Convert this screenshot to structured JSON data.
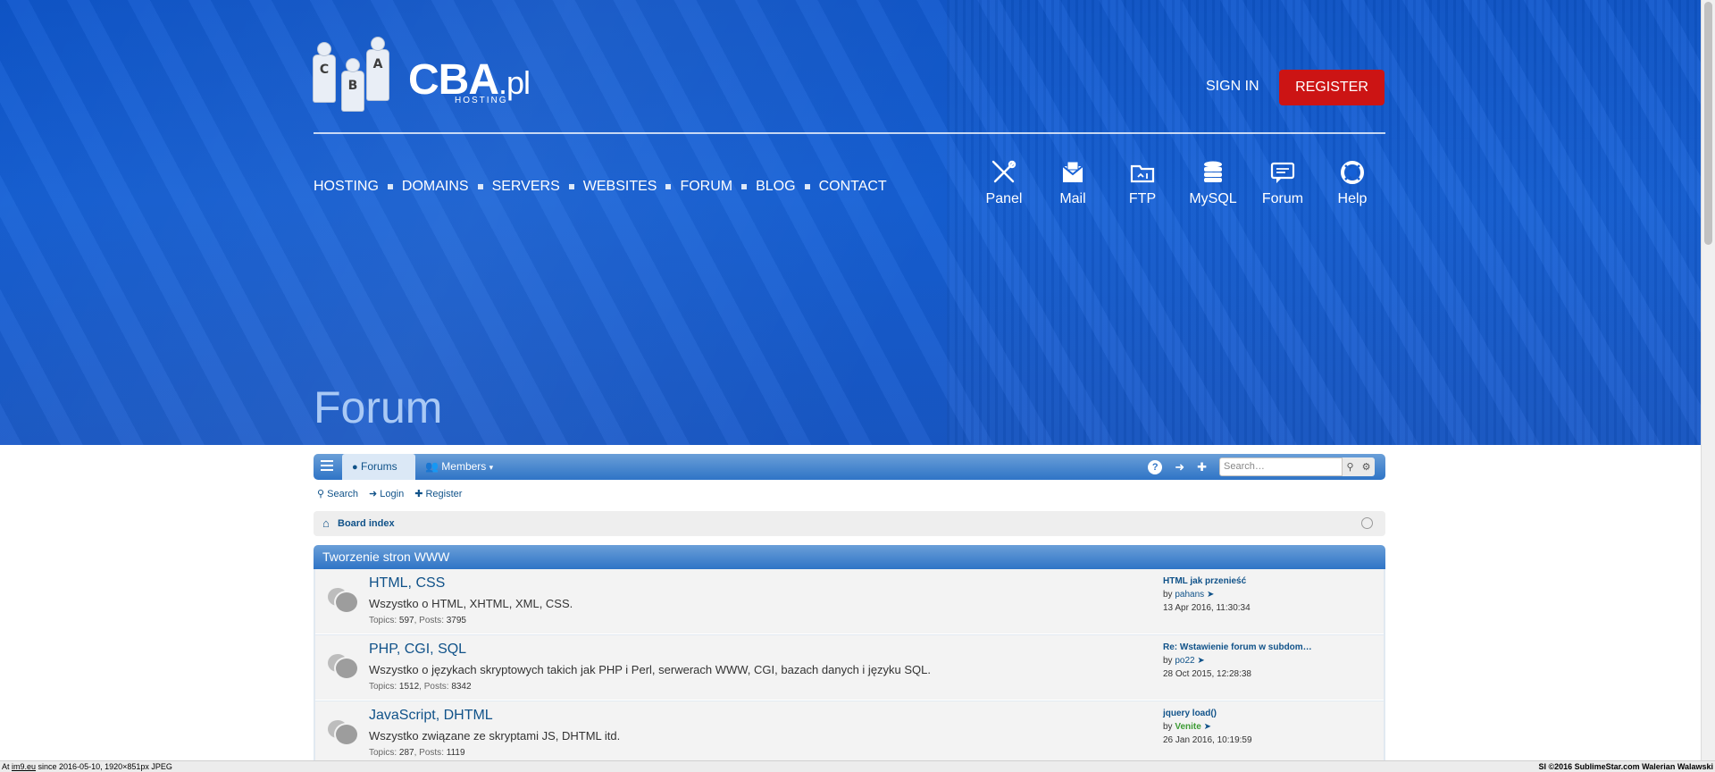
{
  "header": {
    "logo_text": "CBA",
    "logo_tld": ".pl",
    "logo_sub": "HOSTING",
    "logo_people_letters": [
      "C",
      "B",
      "A"
    ],
    "signin_label": "SIGN IN",
    "register_label": "REGISTER",
    "colors": {
      "accent": "#1560d6",
      "register": "#cc1414"
    }
  },
  "topnav": {
    "items": [
      "HOSTING",
      "DOMAINS",
      "SERVERS",
      "WEBSITES",
      "FORUM",
      "BLOG",
      "CONTACT"
    ]
  },
  "quick_links": [
    {
      "label": "Panel",
      "icon": "tools-icon"
    },
    {
      "label": "Mail",
      "icon": "mail-icon"
    },
    {
      "label": "FTP",
      "icon": "ftp-folder-icon"
    },
    {
      "label": "MySQL",
      "icon": "database-icon"
    },
    {
      "label": "Forum",
      "icon": "chat-icon"
    },
    {
      "label": "Help",
      "icon": "lifebuoy-icon"
    }
  ],
  "hero_title": "Forum",
  "forum_nav": {
    "forums_tab": "Forums",
    "members_tab": "Members",
    "search_placeholder": "Search…"
  },
  "sublinks": {
    "search": "Search",
    "login": "Login",
    "register": "Register"
  },
  "breadcrumb": {
    "board_index": "Board index"
  },
  "category": {
    "title": "Tworzenie stron WWW",
    "forums": [
      {
        "title": "HTML, CSS",
        "description": "Wszystko o HTML, XHTML, XML, CSS.",
        "topics_label": "Topics",
        "topics": "597",
        "posts_label": "Posts",
        "posts": "3795",
        "last_post_title": "HTML jak przenieść",
        "last_post_by_label": "by",
        "last_post_author": "pahans",
        "last_post_date": "13 Apr 2016, 11:30:34"
      },
      {
        "title": "PHP, CGI, SQL",
        "description": "Wszystko o językach skryptowych takich jak PHP i Perl, serwerach WWW, CGI, bazach danych i języku SQL.",
        "topics_label": "Topics",
        "topics": "1512",
        "posts_label": "Posts",
        "posts": "8342",
        "last_post_title": "Re: Wstawienie forum w subdom…",
        "last_post_by_label": "by",
        "last_post_author": "po22",
        "last_post_date": "28 Oct 2015, 12:28:38"
      },
      {
        "title": "JavaScript, DHTML",
        "description": "Wszystko związane ze skryptami JS, DHTML itd.",
        "topics_label": "Topics",
        "topics": "287",
        "posts_label": "Posts",
        "posts": "1119",
        "last_post_title": "jquery load()",
        "last_post_by_label": "by",
        "last_post_author": "Venite",
        "last_post_date": "26 Jan 2016, 10:19:59"
      }
    ]
  },
  "footer": {
    "left_prefix": "At ",
    "left_link": "im9.eu",
    "left_suffix": " since 2016-05-10, 1920×851px JPEG",
    "right": "SI ©2016 SublimeStar.com Walerian Walawski"
  }
}
